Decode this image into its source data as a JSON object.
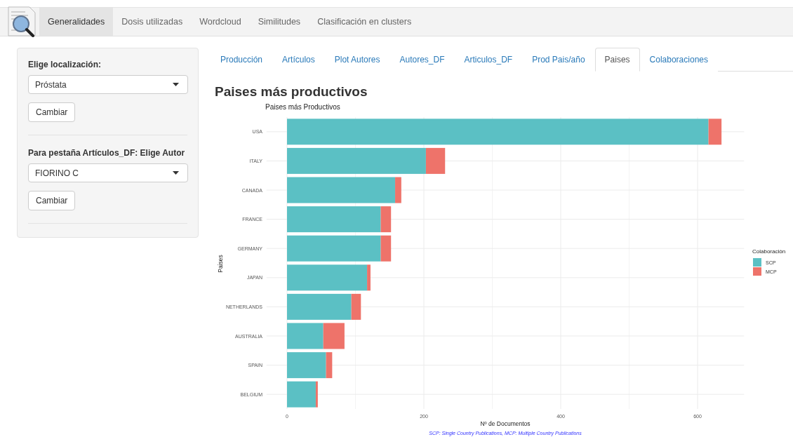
{
  "navbar": {
    "tabs": [
      {
        "label": "Generalidades",
        "selected": true
      },
      {
        "label": "Dosis utilizadas",
        "selected": false
      },
      {
        "label": "Wordcloud",
        "selected": false
      },
      {
        "label": "Similitudes",
        "selected": false
      },
      {
        "label": "Clasificación en clusters",
        "selected": false
      }
    ]
  },
  "sidebar": {
    "sections": [
      {
        "label": "Elige localización:",
        "select_value": "Próstata",
        "button": "Cambiar"
      },
      {
        "label": "Para pestaña Artículos_DF: Elige Autor",
        "select_value": "FIORINO C",
        "button": "Cambiar"
      }
    ]
  },
  "main": {
    "tabs": [
      {
        "label": "Producción",
        "selected": false
      },
      {
        "label": "Artículos",
        "selected": false
      },
      {
        "label": "Plot Autores",
        "selected": false
      },
      {
        "label": "Autores_DF",
        "selected": false
      },
      {
        "label": "Articulos_DF",
        "selected": false
      },
      {
        "label": "Prod Pais/año",
        "selected": false
      },
      {
        "label": "Paises",
        "selected": true
      },
      {
        "label": "Colaboraciones",
        "selected": false
      }
    ],
    "heading": "Paises más productivos",
    "chart_data": {
      "type": "bar",
      "orientation": "horizontal",
      "stacked": true,
      "title": "Paises más Productivos",
      "xlabel": "Nº de Documentos",
      "ylabel": "Paises",
      "categories": [
        "USA",
        "ITALY",
        "CANADA",
        "FRANCE",
        "GERMANY",
        "JAPAN",
        "NETHERLANDS",
        "AUSTRALIA",
        "SPAIN",
        "BELGIUM"
      ],
      "series": [
        {
          "name": "SCP",
          "color": "#5bc0c4",
          "values": [
            616,
            203,
            158,
            137,
            137,
            117,
            94,
            53,
            57,
            42
          ]
        },
        {
          "name": "MCP",
          "color": "#ee736a",
          "values": [
            19,
            28,
            9,
            15,
            15,
            5,
            14,
            31,
            9,
            3
          ]
        }
      ],
      "xlim": [
        -30,
        668
      ],
      "xticks": [
        0,
        200,
        400,
        600
      ],
      "grid": true,
      "legend": {
        "title": "Colaboración"
      },
      "annotations": [
        {
          "text": "SCP: Single Country Publications, MCP: Multiple Country Publications"
        }
      ]
    }
  }
}
